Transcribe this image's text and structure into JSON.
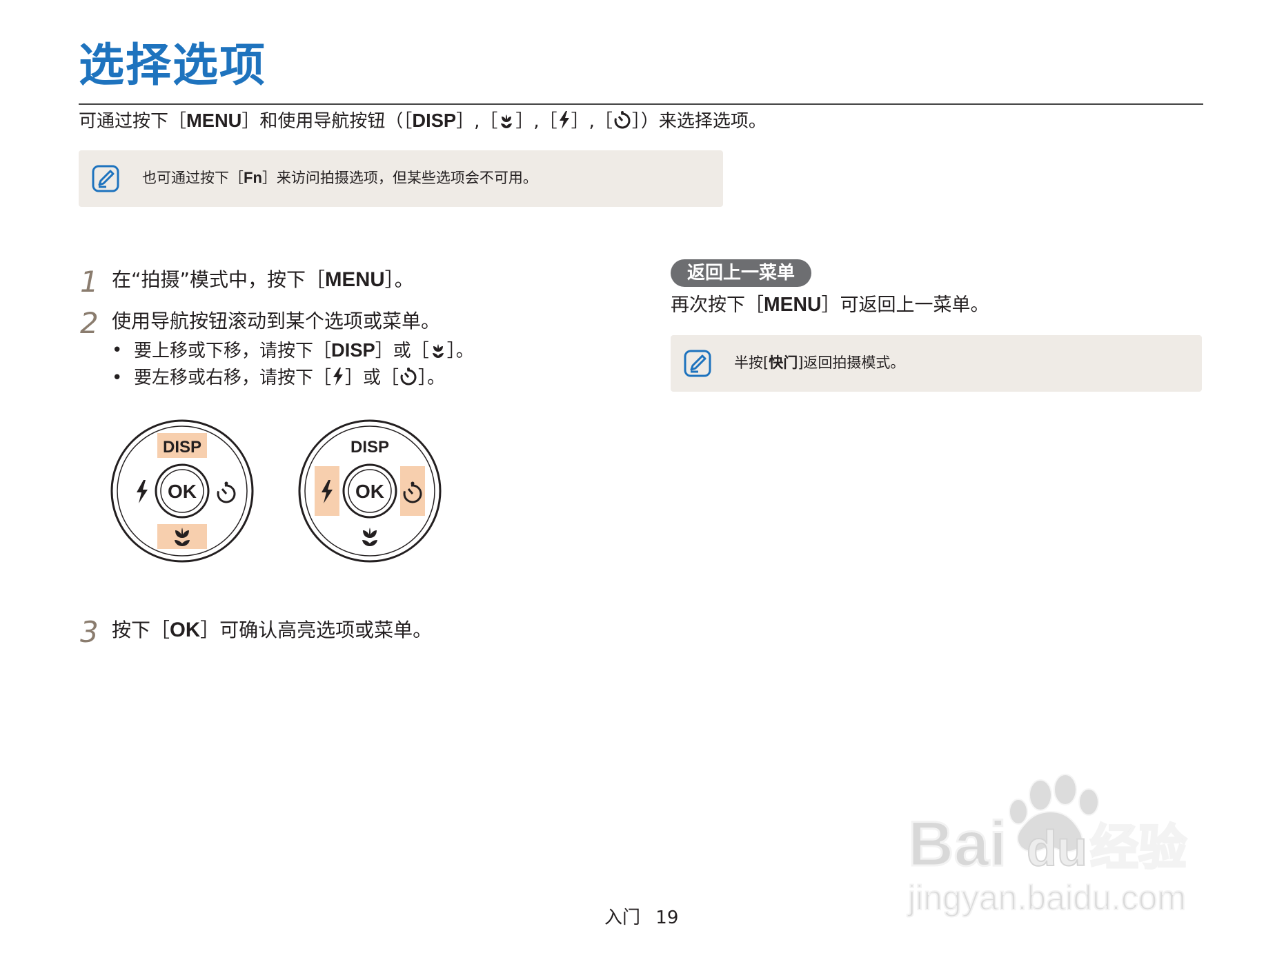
{
  "title": "选择选项",
  "intro": {
    "prefix": "可通过按下［",
    "menu": "MENU",
    "mid": "］和使用导航按钮（［",
    "disp": "DISP",
    "sep1": "］,［",
    "sep2": "］,［",
    "sep3": "］,［",
    "suffix": "］）来选择选项。"
  },
  "note1": {
    "prefix": "也可通过按下［",
    "key": "Fn",
    "suffix": "］来访问拍摄选项，但某些选项会不可用。"
  },
  "steps": [
    {
      "num": "1",
      "prefix": "在“拍摄”模式中，按下［",
      "key": "MENU",
      "suffix": "］。"
    },
    {
      "num": "2",
      "text": "使用导航按钮滚动到某个选项或菜单。"
    },
    {
      "num": "3",
      "prefix": "按下［",
      "key": "OK",
      "suffix": "］可确认高亮选项或菜单。"
    }
  ],
  "bullets": [
    {
      "dot": "•",
      "prefix": "要上移或下移，请按下［",
      "key": "DISP",
      "mid": "］或［",
      "suffix": "］。"
    },
    {
      "dot": "•",
      "prefix": "要左移或右移，请按下［",
      "mid": "］或［",
      "suffix": "］。"
    }
  ],
  "dial": {
    "disp": "DISP",
    "ok": "OK"
  },
  "back": {
    "heading": "返回上一菜单",
    "prefix": "再次按下［",
    "key": "MENU",
    "suffix": "］可返回上一菜单。"
  },
  "note2": {
    "prefix": "半按[",
    "key": "快门",
    "suffix": "]返回拍摄模式。"
  },
  "footer": {
    "section": "入门",
    "page": "19"
  },
  "watermark": {
    "brand": "Bai",
    "brand2": "du",
    "cn": "经验",
    "url": "jingyan.baidu.com"
  },
  "icons": {
    "note": "note-pencil-icon",
    "macro": "macro-flower-icon",
    "flash": "flash-icon",
    "timer": "self-timer-icon",
    "paw": "baidu-paw-icon"
  },
  "colors": {
    "title": "#1e73be",
    "highlight": "#f7cfae",
    "note_bg": "#efebe6",
    "pill": "#6d6e71"
  }
}
